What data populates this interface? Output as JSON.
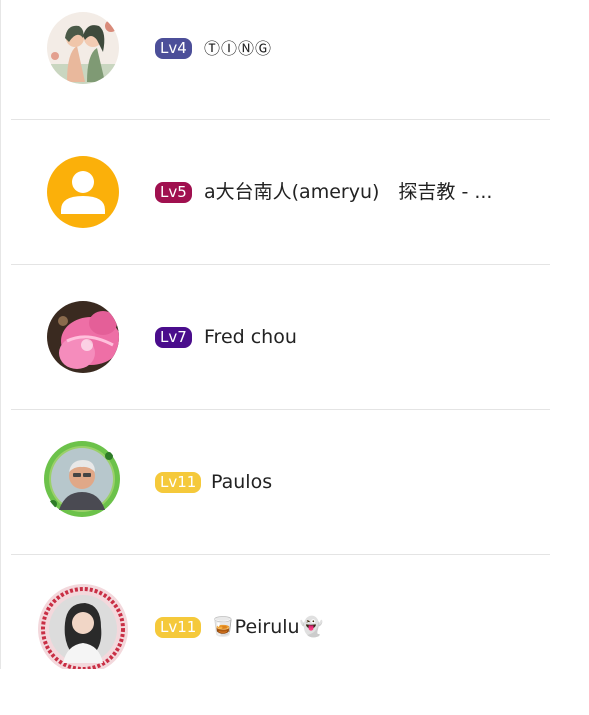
{
  "members": [
    {
      "level": "Lv4",
      "name": "ⓉⒾⓃⒼ",
      "level_color": "#4c4f99",
      "avatar": "couple-illustration-avatar"
    },
    {
      "level": "Lv5",
      "name": "a大台南人(ameryu)　探吉教 - ...",
      "level_color": "#a0104f",
      "avatar": "default-user-avatar"
    },
    {
      "level": "Lv7",
      "name": "Fred chou",
      "level_color": "#4a0d8c",
      "avatar": "pink-flower-avatar"
    },
    {
      "level": "Lv11",
      "name": "Paulos",
      "level_color": "#f5c93b",
      "avatar": "man-photo-avatar"
    },
    {
      "level": "Lv11",
      "name": "Peirulu",
      "level_color": "#f5c93b",
      "avatar": "woman-photo-avatar"
    }
  ],
  "emoji": {
    "drink": "🥃",
    "ghost": "👻"
  }
}
